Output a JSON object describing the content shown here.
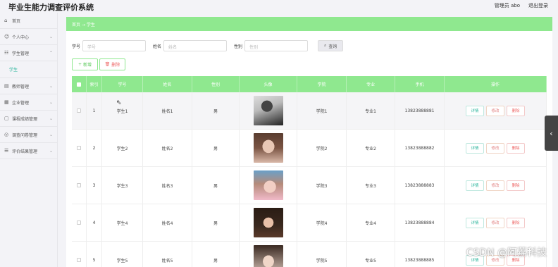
{
  "app": {
    "title": "毕业生能力调查评价系统"
  },
  "topbar": {
    "user": "管理员 abo",
    "logout": "退出登录"
  },
  "sidebar": {
    "items": [
      {
        "label": "首页",
        "icon": "home-icon"
      },
      {
        "label": "个人中心",
        "icon": "user-icon"
      },
      {
        "label": "学生管理",
        "icon": "users-icon"
      },
      {
        "label": "教师管理",
        "icon": "teacher-icon"
      },
      {
        "label": "企业管理",
        "icon": "building-icon"
      },
      {
        "label": "课程成绩管理",
        "icon": "book-icon"
      },
      {
        "label": "调查问卷管理",
        "icon": "survey-icon"
      },
      {
        "label": "评价结果管理",
        "icon": "result-icon"
      }
    ],
    "sub_item": "学生"
  },
  "breadcrumb": {
    "home": "首页",
    "sep": "→",
    "current": "学生"
  },
  "search": {
    "fields": [
      {
        "label": "学号",
        "placeholder": "学号"
      },
      {
        "label": "姓名",
        "placeholder": "姓名"
      },
      {
        "label": "性别",
        "placeholder": "性别"
      }
    ],
    "query_button": "查询"
  },
  "actions": {
    "add": "新增",
    "delete": "删除"
  },
  "table": {
    "headers": [
      "",
      "索引",
      "学号",
      "姓名",
      "性别",
      "头像",
      "学院",
      "专业",
      "手机",
      "操作"
    ],
    "rows": [
      {
        "index": "1",
        "student_no": "学生1",
        "name": "姓名1",
        "gender": "男",
        "college": "学院1",
        "major": "专业1",
        "phone": "13823888881"
      },
      {
        "index": "2",
        "student_no": "学生2",
        "name": "姓名2",
        "gender": "男",
        "college": "学院2",
        "major": "专业2",
        "phone": "13823888882"
      },
      {
        "index": "3",
        "student_no": "学生3",
        "name": "姓名3",
        "gender": "男",
        "college": "学院3",
        "major": "专业3",
        "phone": "13823888883"
      },
      {
        "index": "4",
        "student_no": "学生4",
        "name": "姓名4",
        "gender": "男",
        "college": "学院4",
        "major": "专业4",
        "phone": "13823888884"
      },
      {
        "index": "5",
        "student_no": "学生5",
        "name": "姓名5",
        "gender": "男",
        "college": "学院5",
        "major": "专业5",
        "phone": "13823888885"
      }
    ],
    "ops": {
      "view": "详情",
      "edit": "修改",
      "remove": "删除"
    }
  },
  "watermark": "CSDN @阿荔科技"
}
